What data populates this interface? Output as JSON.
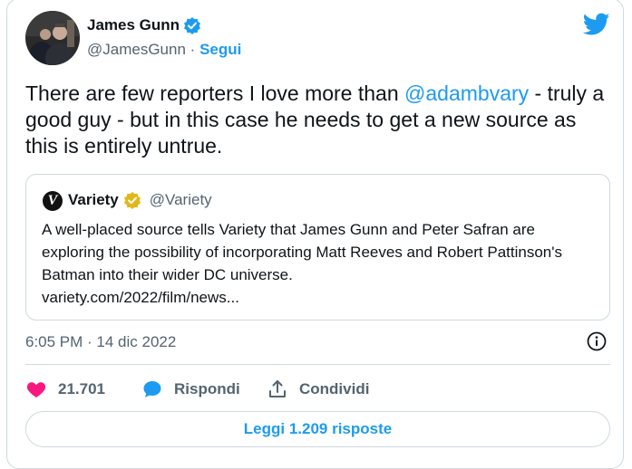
{
  "author": {
    "name": "James Gunn",
    "handle": "@JamesGunn",
    "separator": "·",
    "follow_label": "Segui",
    "verified_icon": "verified-badge-icon",
    "avatar": "avatar"
  },
  "brand_icon": "twitter-bird-icon",
  "tweet": {
    "text_before": "There are few reporters I love more than ",
    "mention": "@adambvary",
    "text_after": " - truly a good guy - but in this case he needs to get a new source as this is entirely untrue."
  },
  "quote": {
    "name": "Variety",
    "handle": "@Variety",
    "logo_glyph": "V",
    "text": "A well-placed source tells Variety that James Gunn and Peter Safran are exploring the possibility of incorporating Matt Reeves and Robert Pattinson's Batman into their wider DC universe.",
    "link": "variety.com/2022/film/news..."
  },
  "timestamp": "6:05 PM · 14 dic 2022",
  "actions": {
    "likes_count": "21.701",
    "reply_label": "Rispondi",
    "share_label": "Condividi"
  },
  "read_replies_label": "Leggi 1.209 risposte",
  "colors": {
    "accent": "#1d9bf0",
    "like": "#f91880",
    "text": "#0f1419",
    "muted": "#536471",
    "border": "#cfd9de",
    "gold_badge": "#e2b719"
  }
}
